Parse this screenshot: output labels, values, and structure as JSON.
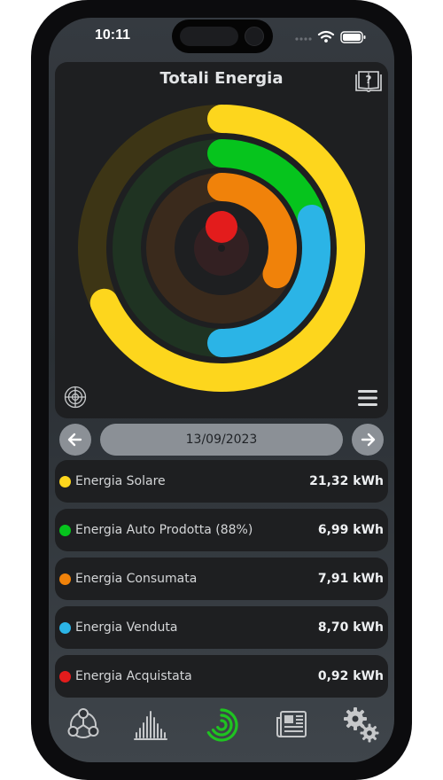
{
  "status_bar": {
    "time": "10:11"
  },
  "header": {
    "title": "Totali Energia",
    "help_icon": "book-question-icon"
  },
  "chart_data": {
    "type": "radial-progress",
    "rings": [
      {
        "name": "Energia Solare",
        "color": "#fdd61d"
      },
      {
        "name": "Energia Auto Prodotta",
        "color": "#06c41d"
      },
      {
        "name": "Energia Consumata",
        "color": "#f0820a"
      },
      {
        "name": "Energia Acquistata",
        "color": "#e31c1c"
      }
    ],
    "inner_arc": {
      "name": "Energia Venduta",
      "color": "#2bb4e6"
    }
  },
  "date_nav": {
    "date": "13/09/2023",
    "prev_icon": "arrow-left-icon",
    "next_icon": "arrow-right-icon"
  },
  "energy_items": [
    {
      "label": "Energia Solare",
      "value": "21,32 kWh",
      "color": "#fdd61d"
    },
    {
      "label": "Energia Auto Prodotta (88%)",
      "value": "6,99 kWh",
      "color": "#06c41d"
    },
    {
      "label": "Energia Consumata",
      "value": "7,91 kWh",
      "color": "#f0820a"
    },
    {
      "label": "Energia Venduta",
      "value": "8,70 kWh",
      "color": "#2bb4e6"
    },
    {
      "label": "Energia Acquistata",
      "value": "0,92 kWh",
      "color": "#e31c1c"
    }
  ],
  "tabbar": {
    "active_tab": "energy-rings",
    "tabs": [
      "network-icon",
      "histogram-icon",
      "energy-rings-icon",
      "newspaper-icon",
      "settings-gears-icon"
    ]
  }
}
